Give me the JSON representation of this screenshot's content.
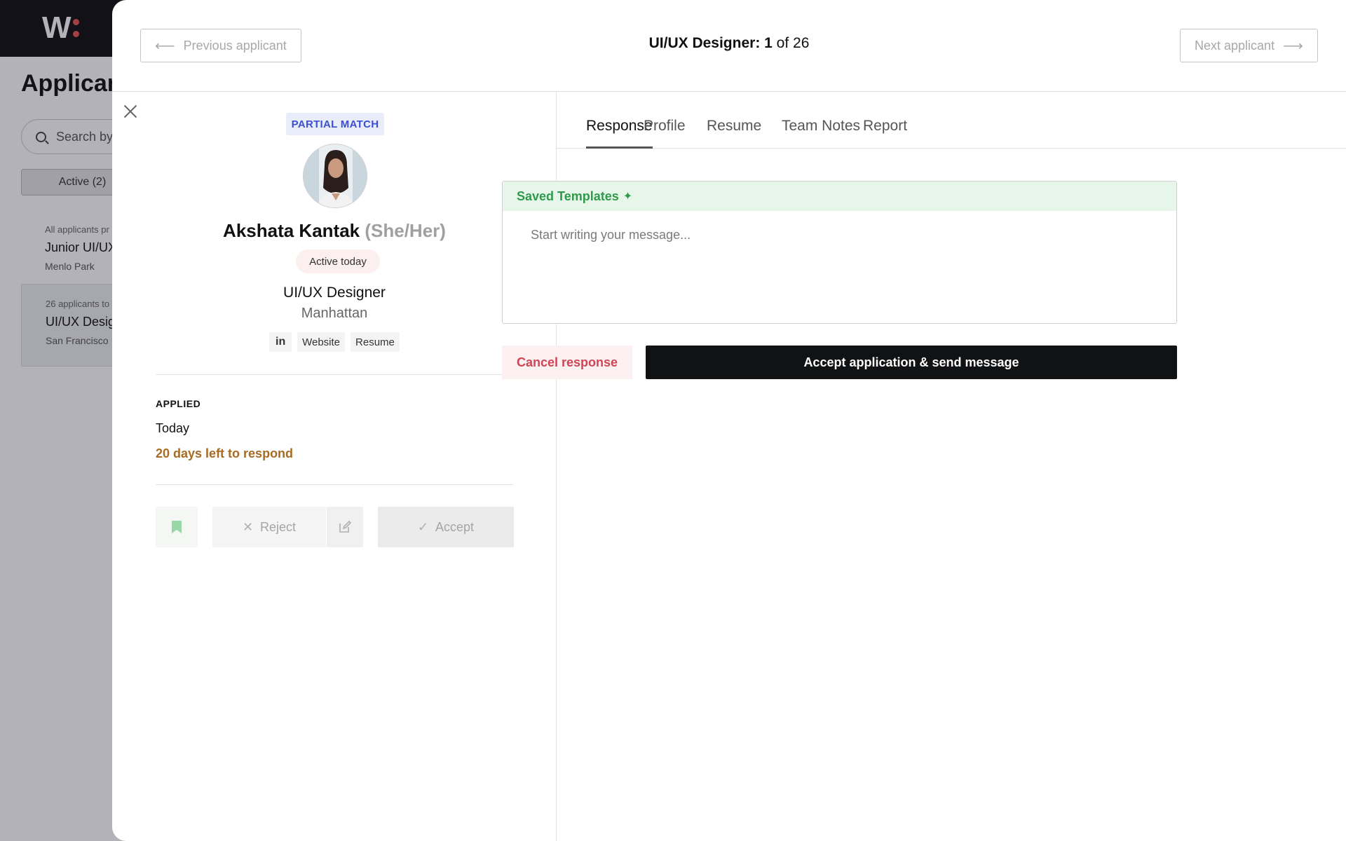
{
  "background": {
    "logo_letter": "W",
    "page_title": "Applicants",
    "search_placeholder": "Search by",
    "active_tab_label": "Active (2)",
    "cards": [
      {
        "meta": "All applicants pr",
        "role": "Junior UI/UX",
        "location": "Menlo Park"
      },
      {
        "meta": "26 applicants to",
        "role": "UI/UX Desig",
        "location": "San Francisco"
      }
    ]
  },
  "header": {
    "prev_label": "Previous applicant",
    "next_label": "Next applicant",
    "title_bold": "UI/UX Designer: 1",
    "title_rest": " of 26"
  },
  "candidate": {
    "match_badge": "PARTIAL MATCH",
    "name": "Akshata Kantak",
    "pronouns": "(She/Her)",
    "activity": "Active today",
    "title": "UI/UX Designer",
    "location": "Manhattan",
    "links": {
      "linkedin": "in",
      "website": "Website",
      "resume": "Resume"
    },
    "applied_label": "APPLIED",
    "applied_when": "Today",
    "days_left": "20 days left to respond"
  },
  "actions": {
    "reject_label": "Reject",
    "accept_label": "Accept"
  },
  "tabs": [
    "Response",
    "Profile",
    "Resume",
    "Team Notes",
    "Report"
  ],
  "active_tab": "Response",
  "composer": {
    "templates_label": "Saved Templates",
    "message_placeholder": "Start writing your message..."
  },
  "buttons": {
    "cancel_label": "Cancel response",
    "send_label": "Accept application & send message"
  },
  "colors": {
    "match_badge_text": "#3b4fd0",
    "days_left": "#a86b22",
    "templates_text": "#2f9a4c",
    "cancel_text": "#d04555",
    "send_bg": "#111214"
  }
}
